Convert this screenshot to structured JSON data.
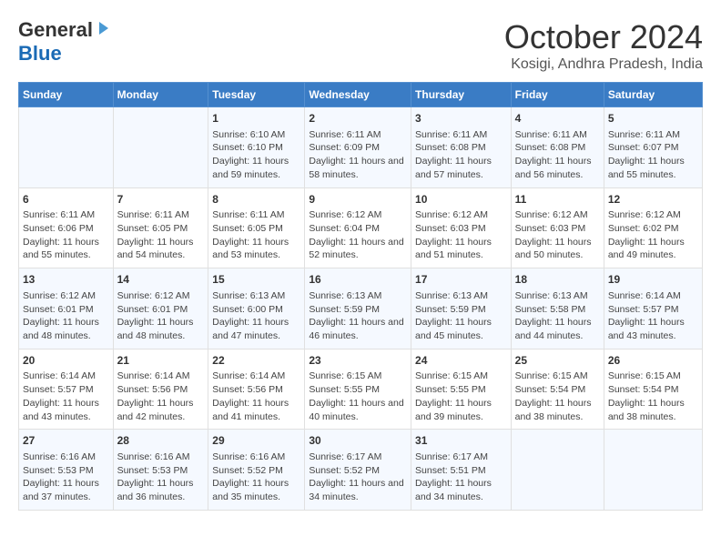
{
  "header": {
    "logo_line1": "General",
    "logo_line2": "Blue",
    "title": "October 2024",
    "subtitle": "Kosigi, Andhra Pradesh, India"
  },
  "days_of_week": [
    "Sunday",
    "Monday",
    "Tuesday",
    "Wednesday",
    "Thursday",
    "Friday",
    "Saturday"
  ],
  "weeks": [
    [
      {
        "day": "",
        "info": ""
      },
      {
        "day": "",
        "info": ""
      },
      {
        "day": "1",
        "info": "Sunrise: 6:10 AM\nSunset: 6:10 PM\nDaylight: 11 hours and 59 minutes."
      },
      {
        "day": "2",
        "info": "Sunrise: 6:11 AM\nSunset: 6:09 PM\nDaylight: 11 hours and 58 minutes."
      },
      {
        "day": "3",
        "info": "Sunrise: 6:11 AM\nSunset: 6:08 PM\nDaylight: 11 hours and 57 minutes."
      },
      {
        "day": "4",
        "info": "Sunrise: 6:11 AM\nSunset: 6:08 PM\nDaylight: 11 hours and 56 minutes."
      },
      {
        "day": "5",
        "info": "Sunrise: 6:11 AM\nSunset: 6:07 PM\nDaylight: 11 hours and 55 minutes."
      }
    ],
    [
      {
        "day": "6",
        "info": "Sunrise: 6:11 AM\nSunset: 6:06 PM\nDaylight: 11 hours and 55 minutes."
      },
      {
        "day": "7",
        "info": "Sunrise: 6:11 AM\nSunset: 6:05 PM\nDaylight: 11 hours and 54 minutes."
      },
      {
        "day": "8",
        "info": "Sunrise: 6:11 AM\nSunset: 6:05 PM\nDaylight: 11 hours and 53 minutes."
      },
      {
        "day": "9",
        "info": "Sunrise: 6:12 AM\nSunset: 6:04 PM\nDaylight: 11 hours and 52 minutes."
      },
      {
        "day": "10",
        "info": "Sunrise: 6:12 AM\nSunset: 6:03 PM\nDaylight: 11 hours and 51 minutes."
      },
      {
        "day": "11",
        "info": "Sunrise: 6:12 AM\nSunset: 6:03 PM\nDaylight: 11 hours and 50 minutes."
      },
      {
        "day": "12",
        "info": "Sunrise: 6:12 AM\nSunset: 6:02 PM\nDaylight: 11 hours and 49 minutes."
      }
    ],
    [
      {
        "day": "13",
        "info": "Sunrise: 6:12 AM\nSunset: 6:01 PM\nDaylight: 11 hours and 48 minutes."
      },
      {
        "day": "14",
        "info": "Sunrise: 6:12 AM\nSunset: 6:01 PM\nDaylight: 11 hours and 48 minutes."
      },
      {
        "day": "15",
        "info": "Sunrise: 6:13 AM\nSunset: 6:00 PM\nDaylight: 11 hours and 47 minutes."
      },
      {
        "day": "16",
        "info": "Sunrise: 6:13 AM\nSunset: 5:59 PM\nDaylight: 11 hours and 46 minutes."
      },
      {
        "day": "17",
        "info": "Sunrise: 6:13 AM\nSunset: 5:59 PM\nDaylight: 11 hours and 45 minutes."
      },
      {
        "day": "18",
        "info": "Sunrise: 6:13 AM\nSunset: 5:58 PM\nDaylight: 11 hours and 44 minutes."
      },
      {
        "day": "19",
        "info": "Sunrise: 6:14 AM\nSunset: 5:57 PM\nDaylight: 11 hours and 43 minutes."
      }
    ],
    [
      {
        "day": "20",
        "info": "Sunrise: 6:14 AM\nSunset: 5:57 PM\nDaylight: 11 hours and 43 minutes."
      },
      {
        "day": "21",
        "info": "Sunrise: 6:14 AM\nSunset: 5:56 PM\nDaylight: 11 hours and 42 minutes."
      },
      {
        "day": "22",
        "info": "Sunrise: 6:14 AM\nSunset: 5:56 PM\nDaylight: 11 hours and 41 minutes."
      },
      {
        "day": "23",
        "info": "Sunrise: 6:15 AM\nSunset: 5:55 PM\nDaylight: 11 hours and 40 minutes."
      },
      {
        "day": "24",
        "info": "Sunrise: 6:15 AM\nSunset: 5:55 PM\nDaylight: 11 hours and 39 minutes."
      },
      {
        "day": "25",
        "info": "Sunrise: 6:15 AM\nSunset: 5:54 PM\nDaylight: 11 hours and 38 minutes."
      },
      {
        "day": "26",
        "info": "Sunrise: 6:15 AM\nSunset: 5:54 PM\nDaylight: 11 hours and 38 minutes."
      }
    ],
    [
      {
        "day": "27",
        "info": "Sunrise: 6:16 AM\nSunset: 5:53 PM\nDaylight: 11 hours and 37 minutes."
      },
      {
        "day": "28",
        "info": "Sunrise: 6:16 AM\nSunset: 5:53 PM\nDaylight: 11 hours and 36 minutes."
      },
      {
        "day": "29",
        "info": "Sunrise: 6:16 AM\nSunset: 5:52 PM\nDaylight: 11 hours and 35 minutes."
      },
      {
        "day": "30",
        "info": "Sunrise: 6:17 AM\nSunset: 5:52 PM\nDaylight: 11 hours and 34 minutes."
      },
      {
        "day": "31",
        "info": "Sunrise: 6:17 AM\nSunset: 5:51 PM\nDaylight: 11 hours and 34 minutes."
      },
      {
        "day": "",
        "info": ""
      },
      {
        "day": "",
        "info": ""
      }
    ]
  ]
}
